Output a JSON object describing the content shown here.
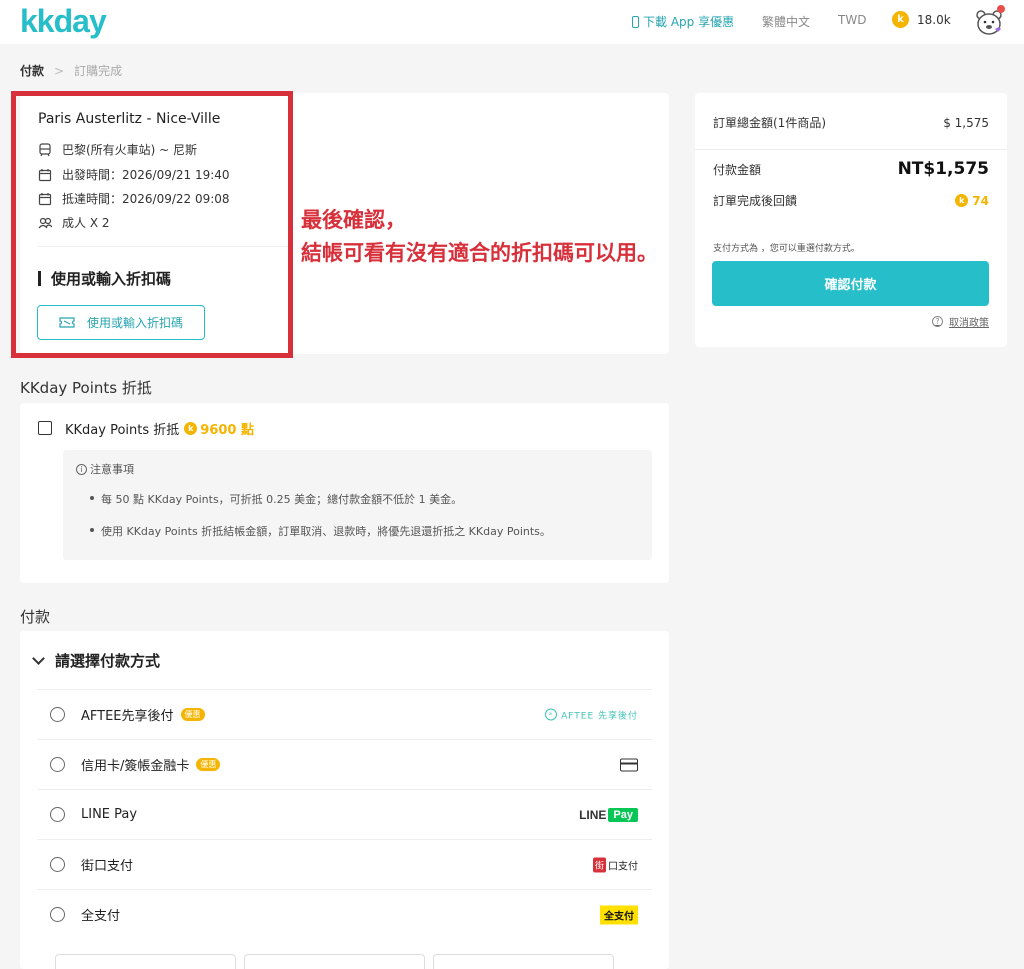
{
  "header": {
    "logo": "kkday",
    "app_link": "下載 App 享優惠",
    "language": "繁體中文",
    "currency": "TWD",
    "points_icon": "k",
    "points": "18.0k"
  },
  "breadcrumb": {
    "current": "付款",
    "separator": ">",
    "next": "訂購完成"
  },
  "product": {
    "title": "Paris Austerlitz - Nice-Ville",
    "route": "巴黎(所有火車站) ~ 尼斯",
    "departure": "出發時間：2026/09/21 19:40",
    "arrival": "抵達時間：2026/09/22 09:08",
    "passengers": "成人 X 2",
    "promo_heading": "使用或輸入折扣碼",
    "promo_button": "使用或輸入折扣碼"
  },
  "annotation": {
    "line1": "最後確認，",
    "line2": "結帳可看有沒有適合的折扣碼可以用。"
  },
  "summary": {
    "total_label": "訂單總金額(1件商品)",
    "total_value": "$ 1,575",
    "pay_label": "付款金額",
    "pay_value": "NT$1,575",
    "reward_label": "訂單完成後回饋",
    "reward_value": "74",
    "note": "支付方式為 ，您可以重選付款方式。",
    "confirm_button": "確認付款",
    "cancel_policy": "取消政策"
  },
  "points_section": {
    "title": "KKday Points 折抵",
    "checkbox_label": "KKday Points 折抵",
    "points_value": "9600 點",
    "notice_title": "注意事項",
    "notice_items": [
      "每 50 點 KKday Points，可折抵 0.25 美金；總付款金額不低於 1 美金。",
      "使用 KKday Points 折抵結帳金額，訂單取消、退款時，將優先退還折抵之 KKday Points。"
    ]
  },
  "payment_section": {
    "title": "付款",
    "heading": "請選擇付款方式",
    "badge": "優惠",
    "methods": [
      {
        "name": "AFTEE先享後付",
        "logo": "AFTEE 先享後付"
      },
      {
        "name": "信用卡/簽帳金融卡"
      },
      {
        "name": "LINE Pay",
        "logo_a": "LINE",
        "logo_b": "Pay"
      },
      {
        "name": "街口支付",
        "logo_a": "街",
        "logo_b": "口支付"
      },
      {
        "name": "全支付",
        "logo": "全支付"
      }
    ]
  }
}
